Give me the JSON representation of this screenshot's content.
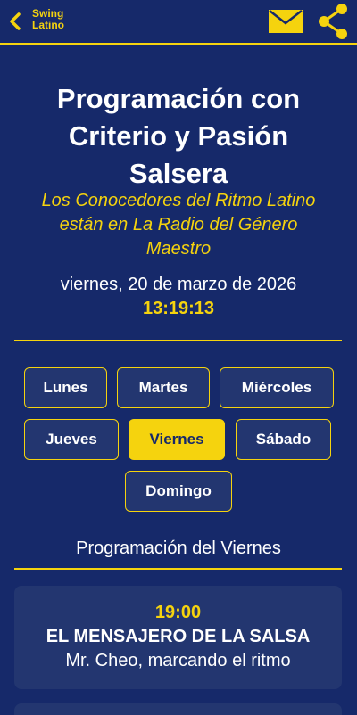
{
  "header": {
    "brand_line1": "Swing",
    "brand_line2": "Latino",
    "back_icon": "chevron-left-icon",
    "mail_icon": "mail-icon",
    "share_icon": "share-icon"
  },
  "hero": {
    "title": "Programación con Criterio y Pasión Salsera",
    "subtitle": "Los Conocedores del Ritmo Latino están en La Radio del Género Maestro",
    "date": "viernes, 20 de marzo de 2026",
    "time": "13:19:13"
  },
  "days": [
    {
      "label": "Lunes",
      "active": false
    },
    {
      "label": "Martes",
      "active": false
    },
    {
      "label": "Miércoles",
      "active": false
    },
    {
      "label": "Jueves",
      "active": false
    },
    {
      "label": "Viernes",
      "active": true
    },
    {
      "label": "Sábado",
      "active": false
    },
    {
      "label": "Domingo",
      "active": false
    }
  ],
  "schedule": {
    "title": "Programación del Viernes",
    "items": [
      {
        "time": "19:00",
        "name": "EL MENSAJERO DE LA SALSA",
        "host": "Mr. Cheo, marcando el ritmo"
      }
    ]
  },
  "colors": {
    "background": "#16296a",
    "accent": "#f5d30e",
    "card": "#233670"
  }
}
